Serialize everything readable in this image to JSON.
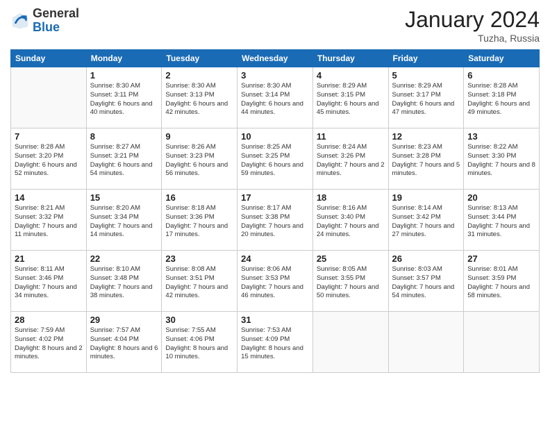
{
  "header": {
    "logo_general": "General",
    "logo_blue": "Blue",
    "month_title": "January 2024",
    "location": "Tuzha, Russia"
  },
  "weekdays": [
    "Sunday",
    "Monday",
    "Tuesday",
    "Wednesday",
    "Thursday",
    "Friday",
    "Saturday"
  ],
  "weeks": [
    [
      {
        "day": null
      },
      {
        "day": "1",
        "sunrise": "Sunrise: 8:30 AM",
        "sunset": "Sunset: 3:11 PM",
        "daylight": "Daylight: 6 hours and 40 minutes."
      },
      {
        "day": "2",
        "sunrise": "Sunrise: 8:30 AM",
        "sunset": "Sunset: 3:13 PM",
        "daylight": "Daylight: 6 hours and 42 minutes."
      },
      {
        "day": "3",
        "sunrise": "Sunrise: 8:30 AM",
        "sunset": "Sunset: 3:14 PM",
        "daylight": "Daylight: 6 hours and 44 minutes."
      },
      {
        "day": "4",
        "sunrise": "Sunrise: 8:29 AM",
        "sunset": "Sunset: 3:15 PM",
        "daylight": "Daylight: 6 hours and 45 minutes."
      },
      {
        "day": "5",
        "sunrise": "Sunrise: 8:29 AM",
        "sunset": "Sunset: 3:17 PM",
        "daylight": "Daylight: 6 hours and 47 minutes."
      },
      {
        "day": "6",
        "sunrise": "Sunrise: 8:28 AM",
        "sunset": "Sunset: 3:18 PM",
        "daylight": "Daylight: 6 hours and 49 minutes."
      }
    ],
    [
      {
        "day": "7",
        "sunrise": "Sunrise: 8:28 AM",
        "sunset": "Sunset: 3:20 PM",
        "daylight": "Daylight: 6 hours and 52 minutes."
      },
      {
        "day": "8",
        "sunrise": "Sunrise: 8:27 AM",
        "sunset": "Sunset: 3:21 PM",
        "daylight": "Daylight: 6 hours and 54 minutes."
      },
      {
        "day": "9",
        "sunrise": "Sunrise: 8:26 AM",
        "sunset": "Sunset: 3:23 PM",
        "daylight": "Daylight: 6 hours and 56 minutes."
      },
      {
        "day": "10",
        "sunrise": "Sunrise: 8:25 AM",
        "sunset": "Sunset: 3:25 PM",
        "daylight": "Daylight: 6 hours and 59 minutes."
      },
      {
        "day": "11",
        "sunrise": "Sunrise: 8:24 AM",
        "sunset": "Sunset: 3:26 PM",
        "daylight": "Daylight: 7 hours and 2 minutes."
      },
      {
        "day": "12",
        "sunrise": "Sunrise: 8:23 AM",
        "sunset": "Sunset: 3:28 PM",
        "daylight": "Daylight: 7 hours and 5 minutes."
      },
      {
        "day": "13",
        "sunrise": "Sunrise: 8:22 AM",
        "sunset": "Sunset: 3:30 PM",
        "daylight": "Daylight: 7 hours and 8 minutes."
      }
    ],
    [
      {
        "day": "14",
        "sunrise": "Sunrise: 8:21 AM",
        "sunset": "Sunset: 3:32 PM",
        "daylight": "Daylight: 7 hours and 11 minutes."
      },
      {
        "day": "15",
        "sunrise": "Sunrise: 8:20 AM",
        "sunset": "Sunset: 3:34 PM",
        "daylight": "Daylight: 7 hours and 14 minutes."
      },
      {
        "day": "16",
        "sunrise": "Sunrise: 8:18 AM",
        "sunset": "Sunset: 3:36 PM",
        "daylight": "Daylight: 7 hours and 17 minutes."
      },
      {
        "day": "17",
        "sunrise": "Sunrise: 8:17 AM",
        "sunset": "Sunset: 3:38 PM",
        "daylight": "Daylight: 7 hours and 20 minutes."
      },
      {
        "day": "18",
        "sunrise": "Sunrise: 8:16 AM",
        "sunset": "Sunset: 3:40 PM",
        "daylight": "Daylight: 7 hours and 24 minutes."
      },
      {
        "day": "19",
        "sunrise": "Sunrise: 8:14 AM",
        "sunset": "Sunset: 3:42 PM",
        "daylight": "Daylight: 7 hours and 27 minutes."
      },
      {
        "day": "20",
        "sunrise": "Sunrise: 8:13 AM",
        "sunset": "Sunset: 3:44 PM",
        "daylight": "Daylight: 7 hours and 31 minutes."
      }
    ],
    [
      {
        "day": "21",
        "sunrise": "Sunrise: 8:11 AM",
        "sunset": "Sunset: 3:46 PM",
        "daylight": "Daylight: 7 hours and 34 minutes."
      },
      {
        "day": "22",
        "sunrise": "Sunrise: 8:10 AM",
        "sunset": "Sunset: 3:48 PM",
        "daylight": "Daylight: 7 hours and 38 minutes."
      },
      {
        "day": "23",
        "sunrise": "Sunrise: 8:08 AM",
        "sunset": "Sunset: 3:51 PM",
        "daylight": "Daylight: 7 hours and 42 minutes."
      },
      {
        "day": "24",
        "sunrise": "Sunrise: 8:06 AM",
        "sunset": "Sunset: 3:53 PM",
        "daylight": "Daylight: 7 hours and 46 minutes."
      },
      {
        "day": "25",
        "sunrise": "Sunrise: 8:05 AM",
        "sunset": "Sunset: 3:55 PM",
        "daylight": "Daylight: 7 hours and 50 minutes."
      },
      {
        "day": "26",
        "sunrise": "Sunrise: 8:03 AM",
        "sunset": "Sunset: 3:57 PM",
        "daylight": "Daylight: 7 hours and 54 minutes."
      },
      {
        "day": "27",
        "sunrise": "Sunrise: 8:01 AM",
        "sunset": "Sunset: 3:59 PM",
        "daylight": "Daylight: 7 hours and 58 minutes."
      }
    ],
    [
      {
        "day": "28",
        "sunrise": "Sunrise: 7:59 AM",
        "sunset": "Sunset: 4:02 PM",
        "daylight": "Daylight: 8 hours and 2 minutes."
      },
      {
        "day": "29",
        "sunrise": "Sunrise: 7:57 AM",
        "sunset": "Sunset: 4:04 PM",
        "daylight": "Daylight: 8 hours and 6 minutes."
      },
      {
        "day": "30",
        "sunrise": "Sunrise: 7:55 AM",
        "sunset": "Sunset: 4:06 PM",
        "daylight": "Daylight: 8 hours and 10 minutes."
      },
      {
        "day": "31",
        "sunrise": "Sunrise: 7:53 AM",
        "sunset": "Sunset: 4:09 PM",
        "daylight": "Daylight: 8 hours and 15 minutes."
      },
      {
        "day": null
      },
      {
        "day": null
      },
      {
        "day": null
      }
    ]
  ]
}
